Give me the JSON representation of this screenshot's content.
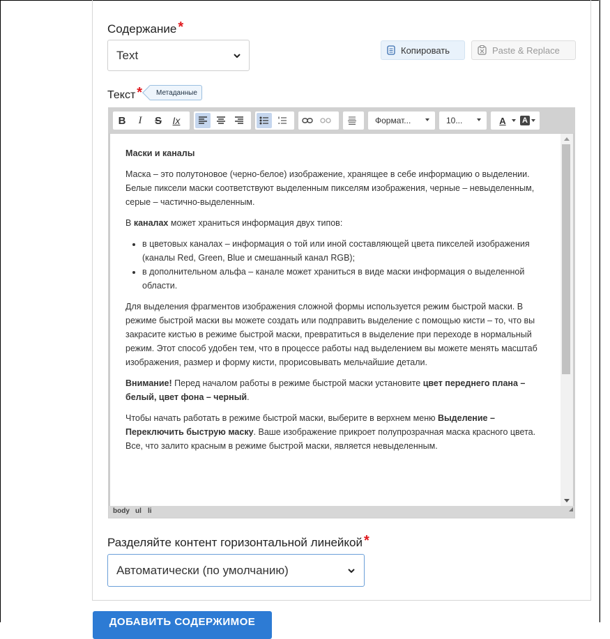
{
  "content_field": {
    "label": "Содержание",
    "required_mark": "*",
    "selected": "Text",
    "copy_button": "Копировать",
    "paste_button": "Paste & Replace"
  },
  "text_field": {
    "label": "Текст",
    "required_mark": "*",
    "badge": "Метаданные"
  },
  "toolbar": {
    "bold": "B",
    "italic": "I",
    "strike": "S",
    "clear_format": "Ix",
    "format_dropdown": "Формат...",
    "size_dropdown": "10...",
    "text_color": "A",
    "bg_color": "A"
  },
  "editor": {
    "heading": "Маски и каналы",
    "p1": "Маска – это полутоновое (черно-белое) изображение, хранящее в себе информацию о выделении. Белые пиксели маски соответствуют выделенным пикселям изображения, черные – невыделенным, серые – частично-выделенным.",
    "p2_prefix": "В ",
    "p2_bold": "каналах",
    "p2_suffix": " может храниться информация двух типов:",
    "li1": "в цветовых каналах – информация о той или иной составляющей цвета пикселей изображения (каналы Red, Green, Blue и смешанный канал RGB);",
    "li2": "в дополнительном альфа – канале может храниться в виде маски информация о выделенной области.",
    "p3": "Для выделения фрагментов изображения сложной формы используется режим быстрой маски. В режиме быстрой маски вы можете создать или подправить выделение с помощью кисти – то, что вы закрасите кистью в режиме быстрой маски, превратиться в выделение при переходе в нормальный режим. Этот способ удобен тем, что в процессе работы над выделением вы можете менять масштаб изображения, размер и форму кисти, прорисовывать мельчайшие детали.",
    "p4_bold1": "Внимание!",
    "p4_text": " Перед началом работы в режиме быстрой маски установите ",
    "p4_bold2": "цвет переднего плана – белый, цвет фона – черный",
    "p4_end": ".",
    "p5_text1": "Чтобы начать работать в режиме быстрой маски, выберите в верхнем меню ",
    "p5_bold": "Выделение – Переключить быструю маску",
    "p5_text2": ". Ваше изображение прикроет полупрозрачная маска красного цвета. Все, что залито красным в режиме быстрой маски, является невыделенным."
  },
  "statusbar": {
    "path1": "body",
    "path2": "ul",
    "path3": "li"
  },
  "separator_field": {
    "label": "Разделяйте контент горизонтальной линейкой",
    "required_mark": "*",
    "selected": "Автоматически (по умолчанию)"
  },
  "submit_button": "ДОБАВИТЬ СОДЕРЖИМОЕ",
  "colors": {
    "primary": "#2d7bd4",
    "required": "#e0191e",
    "focus_border": "#6a9fd8"
  }
}
